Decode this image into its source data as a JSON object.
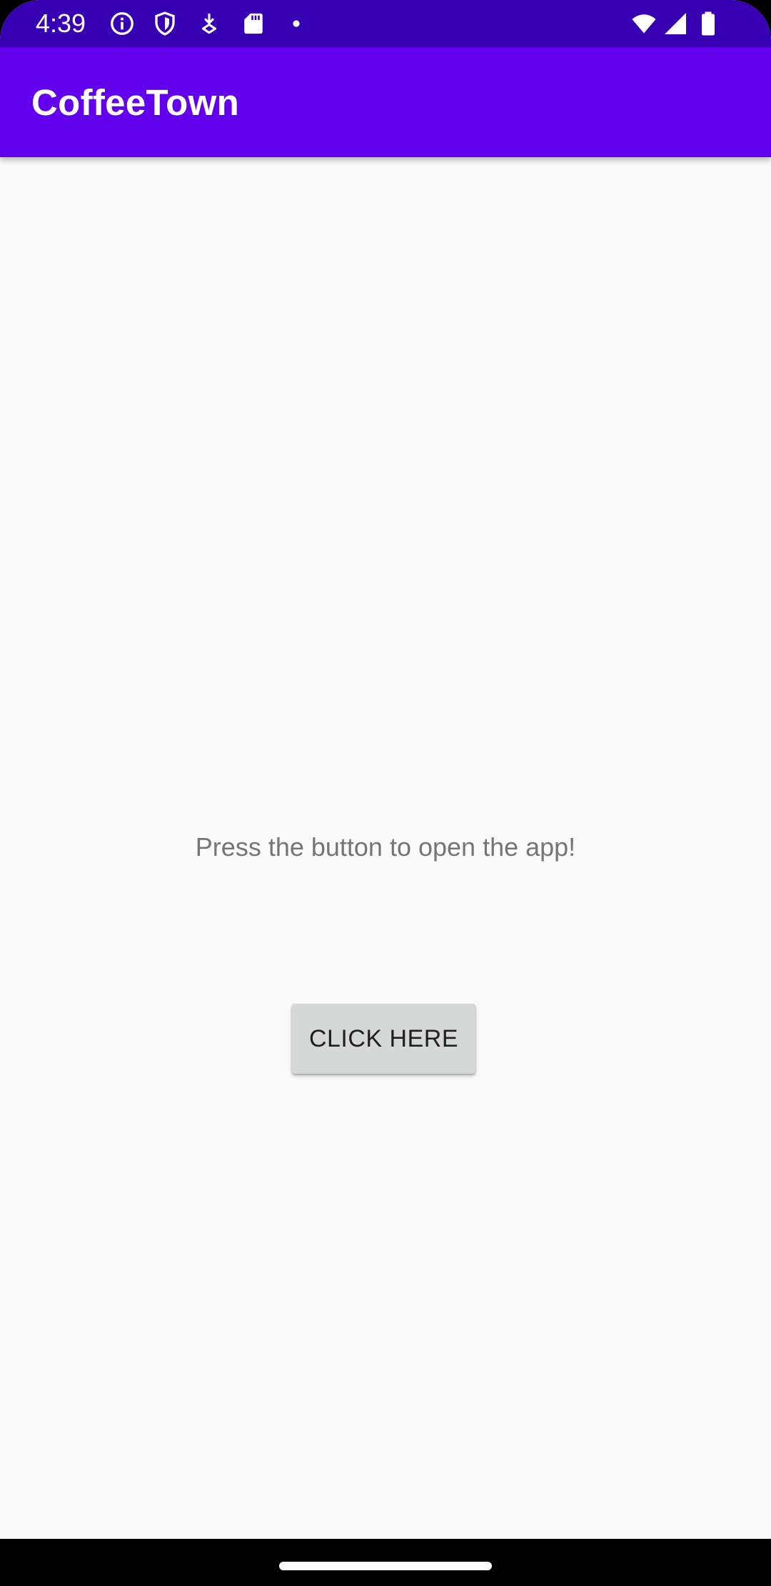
{
  "status_bar": {
    "time": "4:39",
    "background": "#3700b3",
    "left_icons": [
      "info-icon",
      "shield-icon",
      "download-icon",
      "sd-card-icon",
      "dot-icon"
    ],
    "right_icons": [
      "wifi-icon",
      "signal-icon",
      "battery-icon"
    ]
  },
  "app_bar": {
    "title": "CoffeeTown",
    "background": "#6200ee"
  },
  "main": {
    "prompt": "Press the button to open the app!",
    "button_label": "CLICK HERE",
    "button_color": "#d6d7d7"
  },
  "nav_bar": {
    "gesture": "home-handle"
  }
}
